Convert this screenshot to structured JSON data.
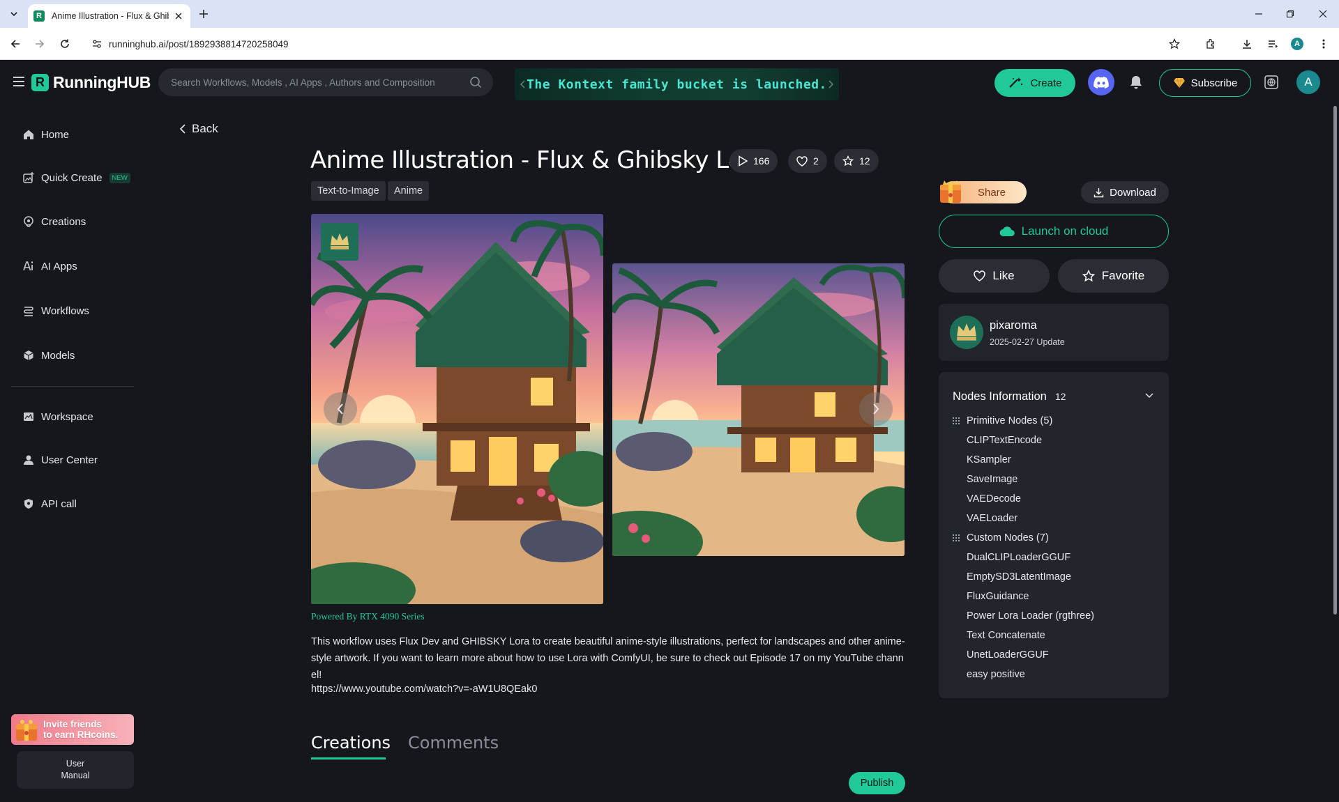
{
  "browser": {
    "tab_title": "Anime Illustration - Flux & Ghibsky Lora",
    "favicon_letter": "R",
    "url": "runninghub.ai/post/1892938814720258049",
    "profile_initial": "A"
  },
  "header": {
    "logo_letter": "R",
    "logo_text": "RunningHUB",
    "search_placeholder": "Search Workflows, Models , AI Apps , Authors and Composition",
    "banner_text": "The Kontext family bucket is launched.",
    "create_label": "Create",
    "subscribe_label": "Subscribe",
    "avatar_initial": "A",
    "accent_color": "#20c997"
  },
  "sidebar": {
    "items": [
      {
        "label": "Home",
        "icon": "home-icon"
      },
      {
        "label": "Quick Create",
        "icon": "quick-create-icon",
        "badge": "NEW"
      },
      {
        "label": "Creations",
        "icon": "creations-icon"
      },
      {
        "label": "AI Apps",
        "icon": "ai-apps-icon"
      },
      {
        "label": "Workflows",
        "icon": "workflows-icon"
      },
      {
        "label": "Models",
        "icon": "models-icon"
      },
      {
        "label": "Workspace",
        "icon": "workspace-icon"
      },
      {
        "label": "User Center",
        "icon": "user-center-icon"
      },
      {
        "label": "API call",
        "icon": "api-icon"
      }
    ],
    "invite_line1": "Invite friends",
    "invite_line2": "to earn RHcoins.",
    "manual_line1": "User",
    "manual_line2": "Manual"
  },
  "post": {
    "back_label": "Back",
    "title": "Anime Illustration - Flux & Ghibsky Lora",
    "runs": "166",
    "likes": "2",
    "favorites": "12",
    "tags": [
      "Text-to-Image",
      "Anime"
    ],
    "powered_by": "Powered By RTX 4090 Series",
    "description": "This workflow uses Flux Dev and GHIBSKY Lora to create beautiful anime-style illustrations, perfect for landscapes and other anime-style artwork. If you want to learn more about how to use Lora with ComfyUI, be sure to check out Episode 17 on my YouTube channel!",
    "link": "https://www.youtube.com/watch?v=-aW1U8QEak0",
    "tabs": [
      "Creations",
      "Comments"
    ],
    "publish_label": "Publish"
  },
  "actions": {
    "share_label": "Share",
    "download_label": "Download",
    "launch_label": "Launch on cloud",
    "like_label": "Like",
    "favorite_label": "Favorite"
  },
  "author": {
    "name": "pixaroma",
    "updated": "2025-02-27 Update"
  },
  "nodes": {
    "title": "Nodes Information",
    "count": "12",
    "primary_group": "Primitive Nodes (5)",
    "primary_items": [
      "CLIPTextEncode",
      "KSampler",
      "SaveImage",
      "VAEDecode",
      "VAELoader"
    ],
    "custom_group": "Custom Nodes (7)",
    "custom_items": [
      "DualCLIPLoaderGGUF",
      "EmptySD3LatentImage",
      "FluxGuidance",
      "Power Lora Loader (rgthree)",
      "Text Concatenate",
      "UnetLoaderGGUF",
      "easy positive"
    ]
  }
}
